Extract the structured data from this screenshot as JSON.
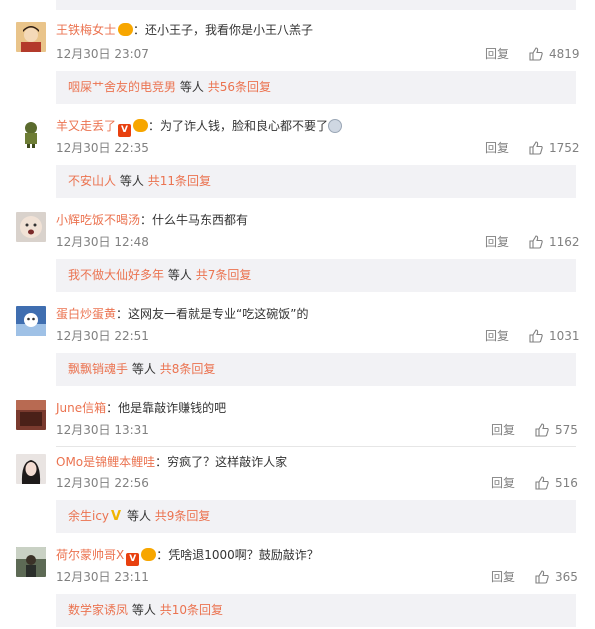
{
  "reply_label": "回复",
  "comments": [
    {
      "username": "王铁梅女士",
      "text": "：还小王子，我看你是小王八羔子",
      "time": "12月30日 23:07",
      "likes": "4819",
      "badges": [
        "fan"
      ],
      "replies": {
        "user": "咽屎艹舍友的电竞男",
        "suffix": "等人",
        "count": "共56条回复"
      }
    },
    {
      "username": "羊又走丢了",
      "text": "：为了诈人钱，脸和良心都不要了",
      "time": "12月30日 22:35",
      "likes": "1752",
      "badges": [
        "vip",
        "fan"
      ],
      "replies": {
        "user": "不安山人",
        "suffix": "等人",
        "count": "共11条回复"
      }
    },
    {
      "username": "小辉吃饭不喝汤",
      "text": "：什么牛马东西都有",
      "time": "12月30日 12:48",
      "likes": "1162",
      "badges": [],
      "replies": {
        "user": "我不做大仙好多年",
        "suffix": "等人",
        "count": "共7条回复"
      }
    },
    {
      "username": "蛋白炒蛋黄",
      "text": "：这网友一看就是专业“吃这碗饭”的",
      "time": "12月30日 22:51",
      "likes": "1031",
      "badges": [],
      "replies": {
        "user": "飘飘销魂手",
        "suffix": "等人",
        "count": "共8条回复"
      }
    },
    {
      "username": "June信箱",
      "text": "：他是靠敲诈赚钱的吧",
      "time": "12月30日 13:31",
      "likes": "575",
      "badges": []
    },
    {
      "username": "OMo是锦鲤本鲤哇",
      "text": "：穷疯了？这样敲诈人家",
      "time": "12月30日 22:56",
      "likes": "516",
      "badges": [],
      "replies": {
        "user": "余生icy",
        "suffix": "等人",
        "count": "共9条回复"
      }
    },
    {
      "username": "荷尔蒙帅哥X",
      "text": "：凭啥退1000啊？鼓励敲诈？",
      "time": "12月30日 23:11",
      "likes": "365",
      "badges": [
        "vip",
        "fan"
      ],
      "replies": {
        "user": "数学家诱凤",
        "suffix": "等人",
        "count": "共10条回复"
      }
    }
  ],
  "icons": {
    "like": "thumbs-up-icon",
    "vip": "vip-badge-icon",
    "fan": "fan-badge-icon"
  },
  "colors": {
    "username": "#eb7350",
    "meta": "#808080",
    "subbox_bg": "#f2f2f5"
  }
}
